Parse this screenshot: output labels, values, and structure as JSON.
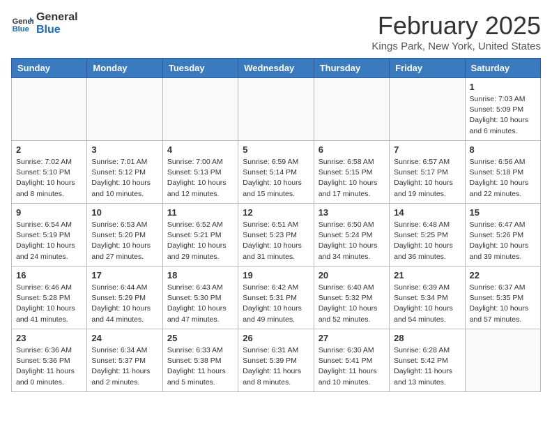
{
  "header": {
    "logo_line1": "General",
    "logo_line2": "Blue",
    "month_title": "February 2025",
    "location": "Kings Park, New York, United States"
  },
  "days_of_week": [
    "Sunday",
    "Monday",
    "Tuesday",
    "Wednesday",
    "Thursday",
    "Friday",
    "Saturday"
  ],
  "weeks": [
    [
      {
        "day": "",
        "info": ""
      },
      {
        "day": "",
        "info": ""
      },
      {
        "day": "",
        "info": ""
      },
      {
        "day": "",
        "info": ""
      },
      {
        "day": "",
        "info": ""
      },
      {
        "day": "",
        "info": ""
      },
      {
        "day": "1",
        "info": "Sunrise: 7:03 AM\nSunset: 5:09 PM\nDaylight: 10 hours\nand 6 minutes."
      }
    ],
    [
      {
        "day": "2",
        "info": "Sunrise: 7:02 AM\nSunset: 5:10 PM\nDaylight: 10 hours\nand 8 minutes."
      },
      {
        "day": "3",
        "info": "Sunrise: 7:01 AM\nSunset: 5:12 PM\nDaylight: 10 hours\nand 10 minutes."
      },
      {
        "day": "4",
        "info": "Sunrise: 7:00 AM\nSunset: 5:13 PM\nDaylight: 10 hours\nand 12 minutes."
      },
      {
        "day": "5",
        "info": "Sunrise: 6:59 AM\nSunset: 5:14 PM\nDaylight: 10 hours\nand 15 minutes."
      },
      {
        "day": "6",
        "info": "Sunrise: 6:58 AM\nSunset: 5:15 PM\nDaylight: 10 hours\nand 17 minutes."
      },
      {
        "day": "7",
        "info": "Sunrise: 6:57 AM\nSunset: 5:17 PM\nDaylight: 10 hours\nand 19 minutes."
      },
      {
        "day": "8",
        "info": "Sunrise: 6:56 AM\nSunset: 5:18 PM\nDaylight: 10 hours\nand 22 minutes."
      }
    ],
    [
      {
        "day": "9",
        "info": "Sunrise: 6:54 AM\nSunset: 5:19 PM\nDaylight: 10 hours\nand 24 minutes."
      },
      {
        "day": "10",
        "info": "Sunrise: 6:53 AM\nSunset: 5:20 PM\nDaylight: 10 hours\nand 27 minutes."
      },
      {
        "day": "11",
        "info": "Sunrise: 6:52 AM\nSunset: 5:21 PM\nDaylight: 10 hours\nand 29 minutes."
      },
      {
        "day": "12",
        "info": "Sunrise: 6:51 AM\nSunset: 5:23 PM\nDaylight: 10 hours\nand 31 minutes."
      },
      {
        "day": "13",
        "info": "Sunrise: 6:50 AM\nSunset: 5:24 PM\nDaylight: 10 hours\nand 34 minutes."
      },
      {
        "day": "14",
        "info": "Sunrise: 6:48 AM\nSunset: 5:25 PM\nDaylight: 10 hours\nand 36 minutes."
      },
      {
        "day": "15",
        "info": "Sunrise: 6:47 AM\nSunset: 5:26 PM\nDaylight: 10 hours\nand 39 minutes."
      }
    ],
    [
      {
        "day": "16",
        "info": "Sunrise: 6:46 AM\nSunset: 5:28 PM\nDaylight: 10 hours\nand 41 minutes."
      },
      {
        "day": "17",
        "info": "Sunrise: 6:44 AM\nSunset: 5:29 PM\nDaylight: 10 hours\nand 44 minutes."
      },
      {
        "day": "18",
        "info": "Sunrise: 6:43 AM\nSunset: 5:30 PM\nDaylight: 10 hours\nand 47 minutes."
      },
      {
        "day": "19",
        "info": "Sunrise: 6:42 AM\nSunset: 5:31 PM\nDaylight: 10 hours\nand 49 minutes."
      },
      {
        "day": "20",
        "info": "Sunrise: 6:40 AM\nSunset: 5:32 PM\nDaylight: 10 hours\nand 52 minutes."
      },
      {
        "day": "21",
        "info": "Sunrise: 6:39 AM\nSunset: 5:34 PM\nDaylight: 10 hours\nand 54 minutes."
      },
      {
        "day": "22",
        "info": "Sunrise: 6:37 AM\nSunset: 5:35 PM\nDaylight: 10 hours\nand 57 minutes."
      }
    ],
    [
      {
        "day": "23",
        "info": "Sunrise: 6:36 AM\nSunset: 5:36 PM\nDaylight: 11 hours\nand 0 minutes."
      },
      {
        "day": "24",
        "info": "Sunrise: 6:34 AM\nSunset: 5:37 PM\nDaylight: 11 hours\nand 2 minutes."
      },
      {
        "day": "25",
        "info": "Sunrise: 6:33 AM\nSunset: 5:38 PM\nDaylight: 11 hours\nand 5 minutes."
      },
      {
        "day": "26",
        "info": "Sunrise: 6:31 AM\nSunset: 5:39 PM\nDaylight: 11 hours\nand 8 minutes."
      },
      {
        "day": "27",
        "info": "Sunrise: 6:30 AM\nSunset: 5:41 PM\nDaylight: 11 hours\nand 10 minutes."
      },
      {
        "day": "28",
        "info": "Sunrise: 6:28 AM\nSunset: 5:42 PM\nDaylight: 11 hours\nand 13 minutes."
      },
      {
        "day": "",
        "info": ""
      }
    ]
  ]
}
